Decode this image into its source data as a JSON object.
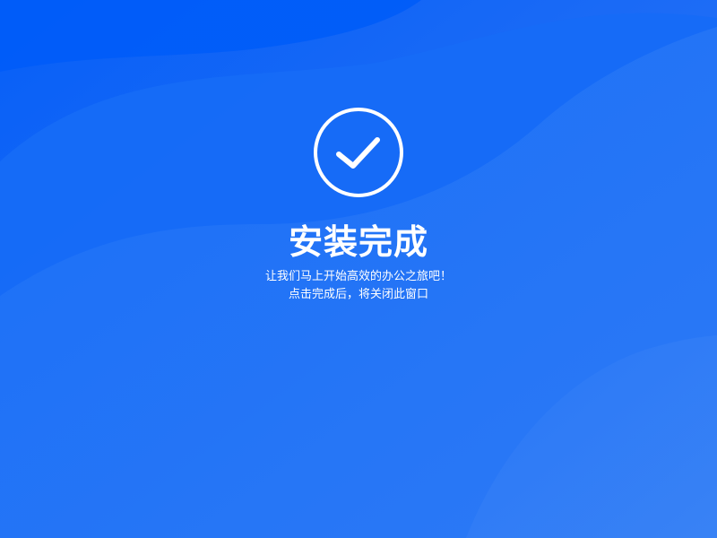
{
  "theme": {
    "background_top": "#0f63f7",
    "background_bottom": "#2f7bf5",
    "accent": "#ffffff"
  },
  "status": {
    "icon": "check-circle-icon",
    "title": "安装完成",
    "line1": "让我们马上开始高效的办公之旅吧！",
    "line2": "点击完成后，将关闭此窗口"
  }
}
